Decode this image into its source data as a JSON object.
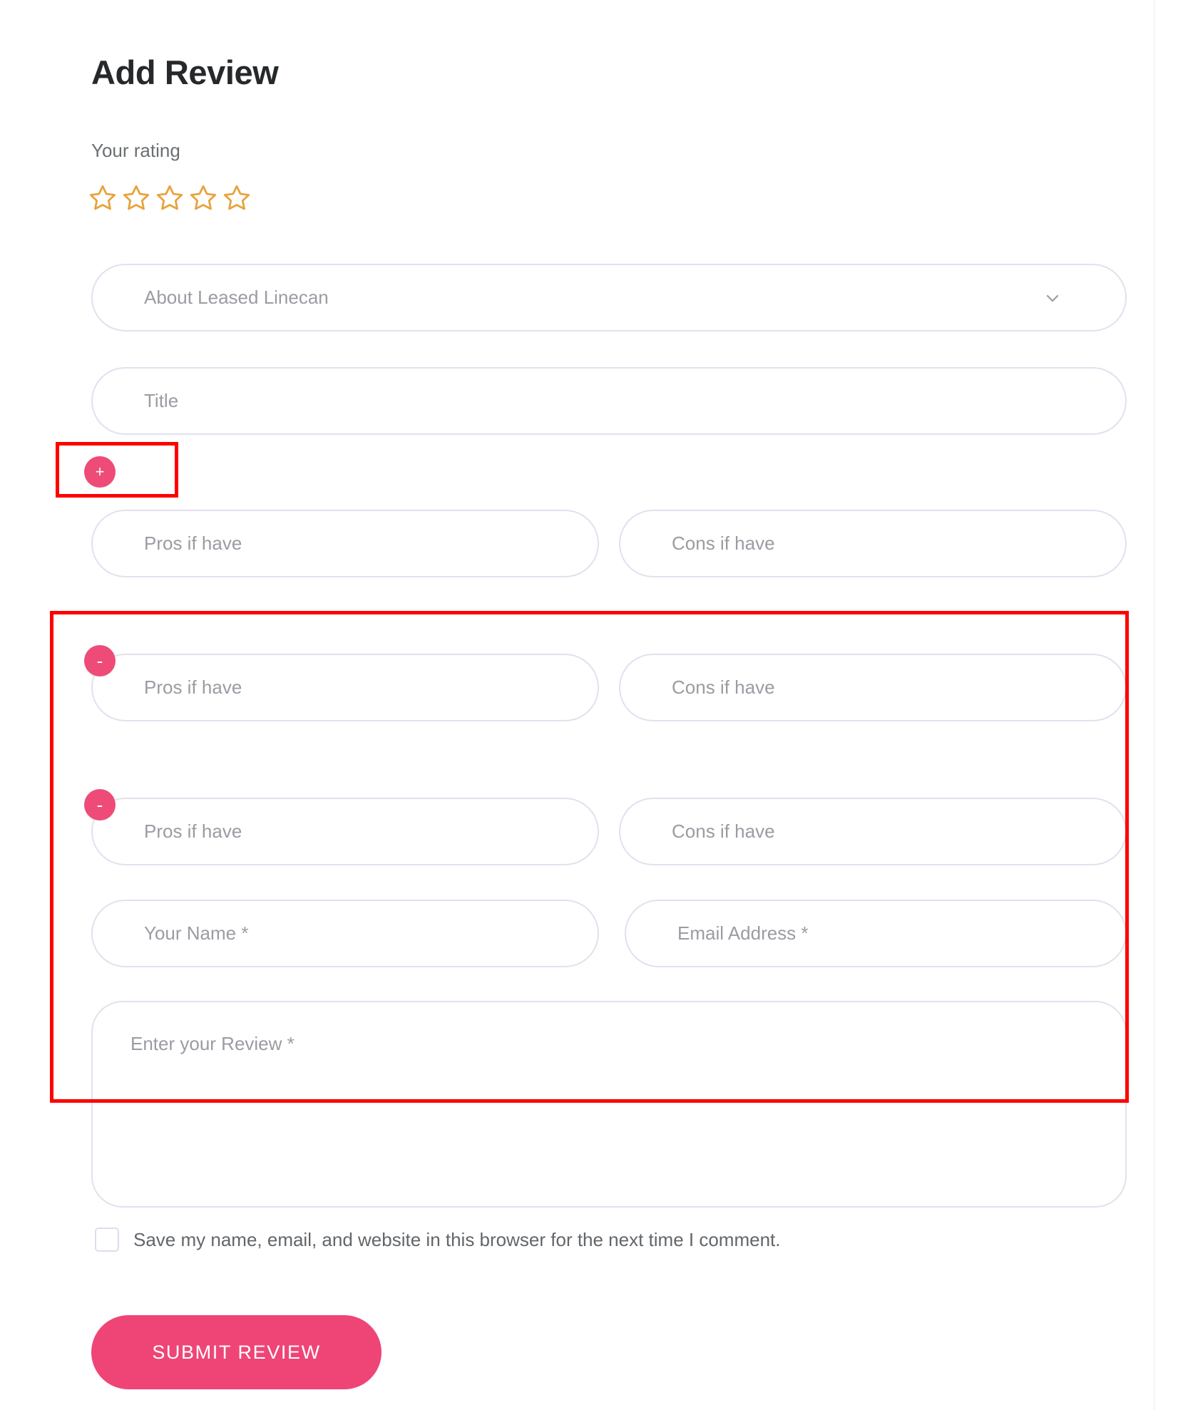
{
  "page": {
    "title": "Add Review"
  },
  "rating": {
    "label": "Your rating",
    "stars_total": 5,
    "stars_selected": 0,
    "star_color": "#e8a33d"
  },
  "fields": {
    "about_select": {
      "value": "About Leased Linecan",
      "icon": "chevron-down-icon"
    },
    "title_input": {
      "placeholder": "Title"
    },
    "pros_row_1": {
      "pros_placeholder": "Pros if have",
      "cons_placeholder": "Cons if have"
    },
    "pros_row_2": {
      "pros_placeholder": "Pros if have",
      "cons_placeholder": "Cons if have"
    },
    "pros_row_3": {
      "pros_placeholder": "Pros if have",
      "cons_placeholder": "Cons if have"
    },
    "name_input": {
      "placeholder": "Your Name *"
    },
    "email_input": {
      "placeholder": "Email Address *"
    },
    "review_textarea": {
      "placeholder": "Enter your Review *"
    }
  },
  "buttons": {
    "add_row_label": "+",
    "remove_row_label": "-",
    "submit_label": "SUBMIT REVIEW",
    "accent_color": "#ef4b78"
  },
  "consent": {
    "checkbox_label": "Save my name, email, and website in this browser for the next time I comment.",
    "checked": false
  },
  "annotations": {
    "highlight_color": "#ff0000",
    "boxes": [
      {
        "name": "add-row-button-highlight"
      },
      {
        "name": "extra-fields-highlight"
      }
    ]
  }
}
